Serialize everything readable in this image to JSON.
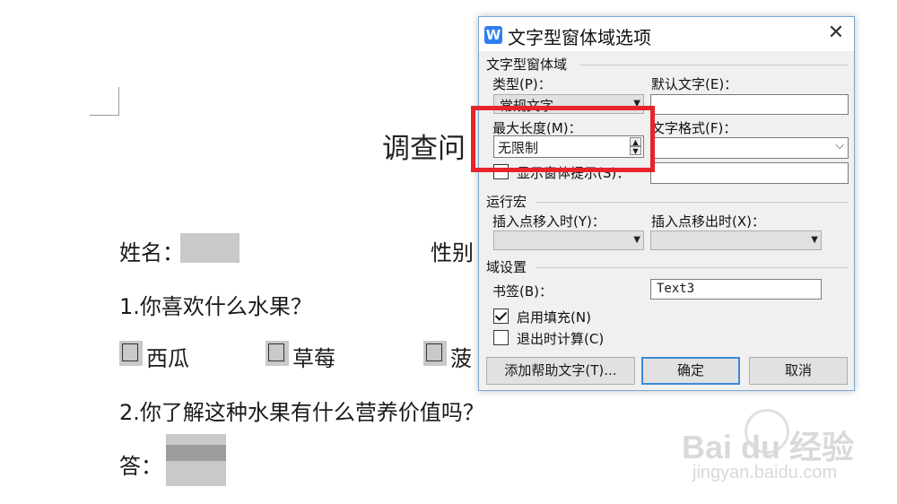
{
  "document": {
    "title": "调查问",
    "name_label": "姓名：",
    "gender_label": "性别",
    "q1": "1.你喜欢什么水果？",
    "options": [
      "西瓜",
      "草莓",
      "菠"
    ],
    "q2": "2.你了解这种水果有什么营养价值吗？",
    "answer_label": "答："
  },
  "dialog": {
    "title": "文字型窗体域选项",
    "app_icon": "W",
    "close": "✕",
    "section_field": "文字型窗体域",
    "type_label": "类型(P)：",
    "type_value": "常规文字",
    "default_text_label": "默认文字(E)：",
    "default_text_value": "",
    "max_length_label": "最大长度(M)：",
    "max_length_value": "无限制",
    "text_format_label": "文字格式(F)：",
    "text_format_value": "",
    "show_tip_label": "显示窗体提示(S)：",
    "show_tip_value": "",
    "section_macro": "运行宏",
    "entry_label": "插入点移入时(Y)：",
    "exit_label": "插入点移出时(X)：",
    "section_settings": "域设置",
    "bookmark_label": "书签(B)：",
    "bookmark_value": "Text3",
    "enable_fill_label": "启用填充(N)",
    "enable_fill_checked": true,
    "calc_on_exit_label": "退出时计算(C)",
    "calc_on_exit_checked": false,
    "help_text_button": "添加帮助文字(T)...",
    "ok_button": "确定",
    "cancel_button": "取消"
  },
  "watermark": {
    "logo": "Bai du 经验",
    "url": "jingyan.baidu.com"
  },
  "colors": {
    "highlight": "#e8232a",
    "accent": "#3c8ad9",
    "app_icon": "#2d7ff0"
  }
}
